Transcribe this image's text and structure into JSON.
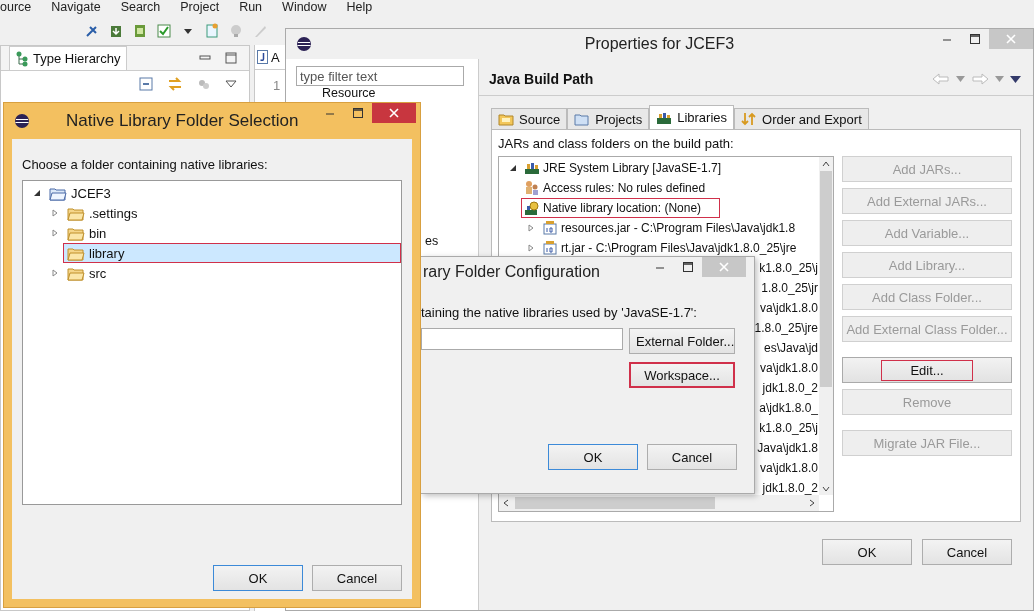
{
  "ide": {
    "menu": [
      "ource",
      "Navigate",
      "Search",
      "Project",
      "Run",
      "Window",
      "Help"
    ],
    "view_tab": "Type Hierarchy",
    "editor_tab": "A",
    "line_number": "1"
  },
  "properties": {
    "title": "Properties for JCEF3",
    "filter": {
      "placeholder": "type filter text"
    },
    "nav_items": [
      "Resource",
      "es"
    ],
    "page_title": "Java Build Path",
    "tabs": [
      {
        "label": "Source",
        "kind": "source",
        "selected": false
      },
      {
        "label": "Projects",
        "kind": "projects",
        "selected": false
      },
      {
        "label": "Libraries",
        "kind": "libraries",
        "selected": true
      },
      {
        "label": "Order and Export",
        "kind": "order",
        "selected": false
      }
    ],
    "list_label": "JARs and class folders on the build path:",
    "jre": {
      "text": "JRE System Library [JavaSE-1.7]",
      "expanded": true,
      "children": [
        {
          "text": "Access rules: No rules defined",
          "kind": "rules",
          "highlighted": false
        },
        {
          "text": "Native library location: (None)",
          "kind": "native",
          "highlighted": true
        }
      ]
    },
    "jars": [
      "resources.jar - C:\\Program Files\\Java\\jdk1.8",
      "rt.jar - C:\\Program Files\\Java\\jdk1.8.0_25\\jre"
    ],
    "covered_rows": [
      "k1.8.0_25\\j",
      "1.8.0_25\\jr",
      "va\\jdk1.8.0",
      "1.8.0_25\\jre",
      "es\\Java\\jd",
      "va\\jdk1.8.0",
      "jdk1.8.0_2",
      "a\\jdk1.8.0_",
      "k1.8.0_25\\j",
      "Java\\jdk1.8",
      "va\\jdk1.8.0",
      "jdk1.8.0_2"
    ],
    "buttons": [
      {
        "label": "Add JARs...",
        "disabled": true,
        "highlighted": false
      },
      {
        "label": "Add External JARs...",
        "disabled": true,
        "highlighted": false
      },
      {
        "label": "Add Variable...",
        "disabled": true,
        "highlighted": false
      },
      {
        "label": "Add Library...",
        "disabled": true,
        "highlighted": false
      },
      {
        "label": "Add Class Folder...",
        "disabled": true,
        "highlighted": false
      },
      {
        "label": "Add External Class Folder...",
        "disabled": true,
        "highlighted": false
      },
      {
        "label": "Edit...",
        "disabled": false,
        "highlighted": true
      },
      {
        "label": "Remove",
        "disabled": true,
        "highlighted": false
      },
      {
        "label": "Migrate JAR File...",
        "disabled": true,
        "highlighted": false
      }
    ],
    "ok": "OK",
    "cancel": "Cancel"
  },
  "folder_selection": {
    "title": "Native Library Folder Selection",
    "label": "Choose a folder containing native libraries:",
    "root": {
      "text": "JCEF3",
      "expanded": true,
      "children": [
        {
          "text": ".settings",
          "kind": "folder",
          "selected": false,
          "highlighted": false
        },
        {
          "text": "bin",
          "kind": "folder",
          "selected": false,
          "highlighted": false
        },
        {
          "text": "library",
          "kind": "leaf",
          "selected": true,
          "highlighted": true
        },
        {
          "text": "src",
          "kind": "folder",
          "selected": false,
          "highlighted": false
        }
      ]
    },
    "ok": "OK",
    "cancel": "Cancel"
  },
  "folder_config": {
    "title": "rary Folder Configuration",
    "label": "taining the native libraries used by 'JavaSE-1.7':",
    "buttons": [
      {
        "label": "External Folder...",
        "highlighted": false
      },
      {
        "label": "Workspace...",
        "highlighted": true
      }
    ],
    "ok": "OK",
    "cancel": "Cancel"
  }
}
